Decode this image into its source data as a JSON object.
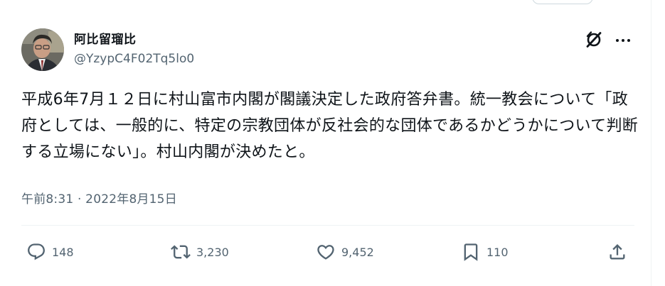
{
  "tweet": {
    "display_name": "阿比留瑠比",
    "handle": "@YzypC4F02Tq5lo0",
    "text": "平成6年7月１２日に村山富市内閣が閣議決定した政府答弁書。統一教会について「政府としては、一般的に、特定の宗教団体が反社会的な団体であるかどうかについて判断する立場にない」。村山内閣が決めたと。",
    "timestamp": "午前8:31 · 2022年8月15日"
  },
  "actions": {
    "replies": "148",
    "retweets": "3,230",
    "likes": "9,452",
    "bookmarks": "110"
  },
  "icons": {
    "header": [
      "grok-icon",
      "more-options-icon"
    ],
    "actions": [
      "reply-icon",
      "retweet-icon",
      "like-icon",
      "bookmark-icon",
      "share-icon"
    ]
  },
  "colors": {
    "text_primary": "#0f1419",
    "text_secondary": "#536471",
    "divider": "#eff3f4"
  }
}
